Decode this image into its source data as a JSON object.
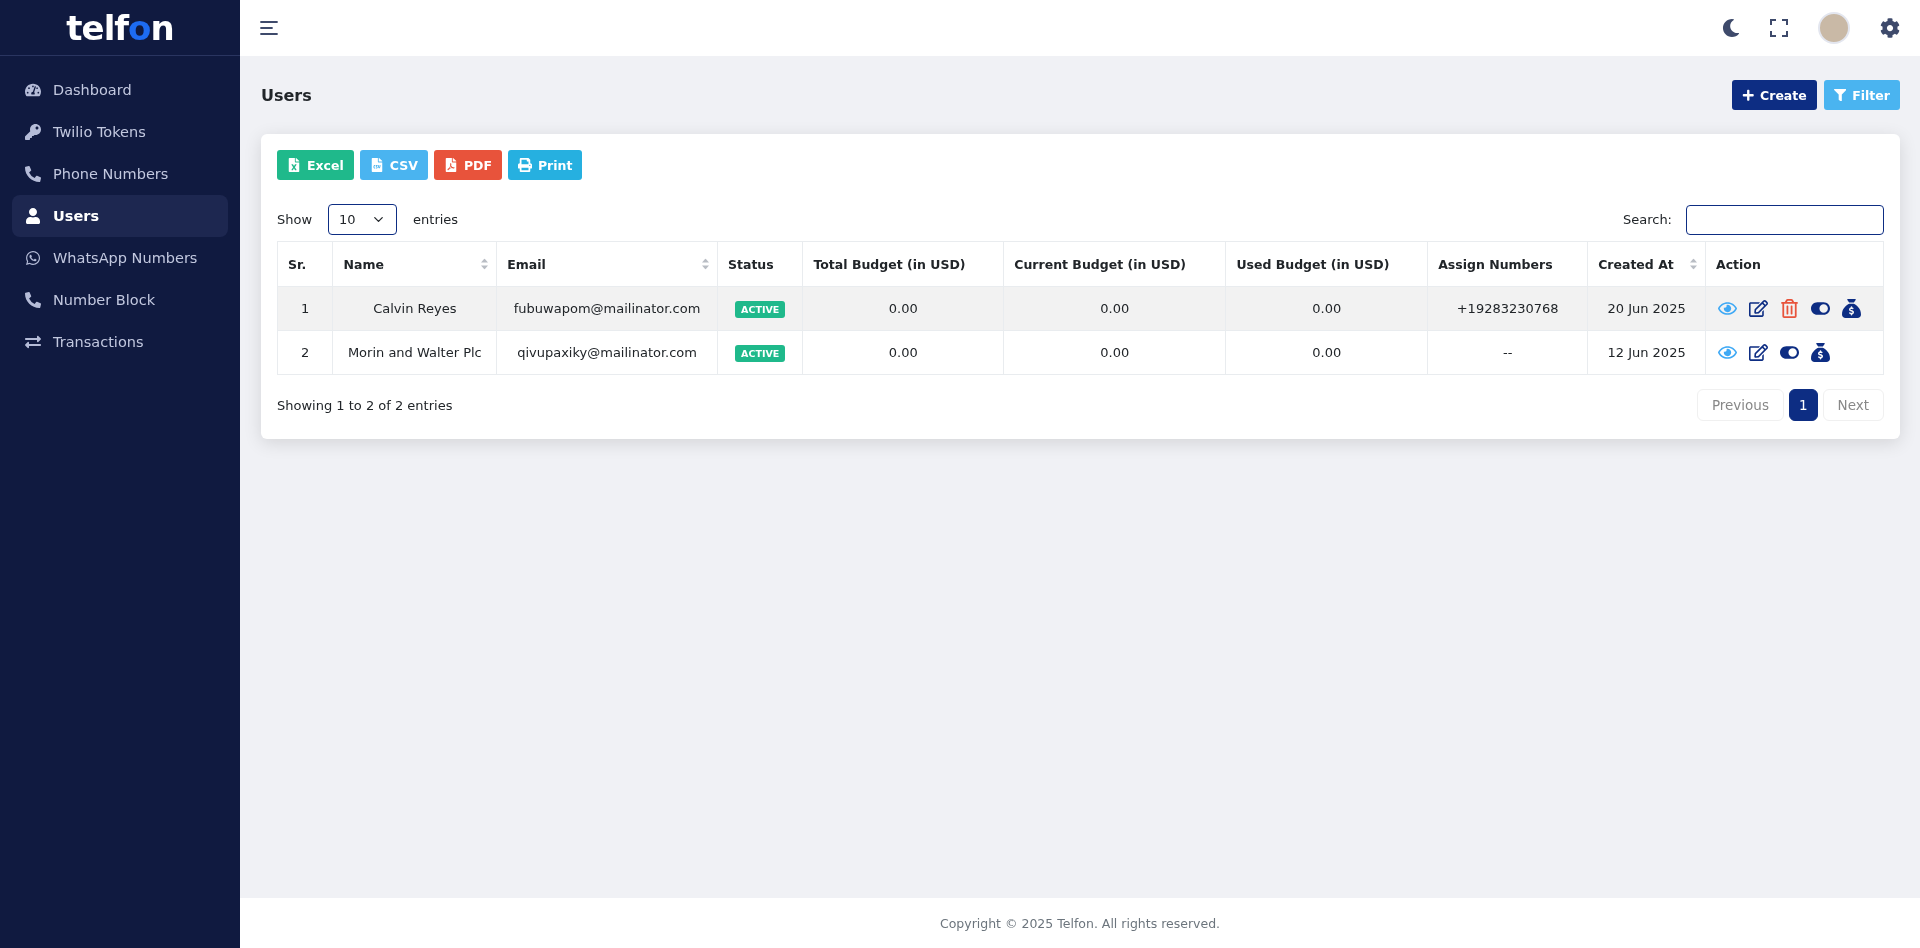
{
  "logo": {
    "before": "telf",
    "accent": "o",
    "after": "n"
  },
  "sidebar": {
    "items": [
      {
        "label": "Dashboard",
        "selected": false
      },
      {
        "label": "Twilio Tokens",
        "selected": false
      },
      {
        "label": "Phone Numbers",
        "selected": false
      },
      {
        "label": "Users",
        "selected": true
      },
      {
        "label": "WhatsApp Numbers",
        "selected": false
      },
      {
        "label": "Number Block",
        "selected": false
      },
      {
        "label": "Transactions",
        "selected": false
      }
    ]
  },
  "page": {
    "title": "Users",
    "actions": [
      "Create",
      "Filter"
    ]
  },
  "export_buttons": [
    "Excel",
    "CSV",
    "PDF",
    "Print"
  ],
  "length_control": {
    "before": "Show",
    "value": "10",
    "after": "entries"
  },
  "search": {
    "label": "Search:"
  },
  "table": {
    "columns": [
      {
        "label": "Sr.",
        "sortable": false
      },
      {
        "label": "Name",
        "sortable": true
      },
      {
        "label": "Email",
        "sortable": true
      },
      {
        "label": "Status",
        "sortable": false
      },
      {
        "label": "Total Budget (in USD)",
        "sortable": false
      },
      {
        "label": "Current Budget (in USD)",
        "sortable": false
      },
      {
        "label": "Used Budget (in USD)",
        "sortable": false
      },
      {
        "label": "Assign Numbers",
        "sortable": false
      },
      {
        "label": "Created At",
        "sortable": true
      },
      {
        "label": "Action",
        "sortable": false
      }
    ],
    "rows": [
      {
        "sr": "1",
        "name": "Calvin Reyes",
        "email": "fubuwapom@mailinator.com",
        "status": "ACTIVE",
        "total": "0.00",
        "current": "0.00",
        "used": "0.00",
        "numbers": "+19283230768",
        "created": "20 Jun 2025",
        "actions": [
          {
            "kind": "view"
          },
          {
            "kind": "edit"
          },
          {
            "kind": "delete"
          },
          {
            "kind": "toggle"
          },
          {
            "kind": "money"
          }
        ]
      },
      {
        "sr": "2",
        "name": "Morin and Walter Plc",
        "email": "qivupaxiky@mailinator.com",
        "status": "ACTIVE",
        "total": "0.00",
        "current": "0.00",
        "used": "0.00",
        "numbers": "--",
        "created": "12 Jun 2025",
        "actions": [
          {
            "kind": "view"
          },
          {
            "kind": "edit"
          },
          {
            "kind": "toggle"
          },
          {
            "kind": "money"
          }
        ]
      }
    ]
  },
  "info": "Showing 1 to 2 of 2 entries",
  "pagination": {
    "previous": {
      "label": "Previous",
      "disabled": true
    },
    "pages": [
      {
        "label": "1",
        "selected": true
      }
    ],
    "next": {
      "label": "Next",
      "disabled": true
    }
  },
  "footer": "Copyright © 2025 Telfon. All rights reserved."
}
